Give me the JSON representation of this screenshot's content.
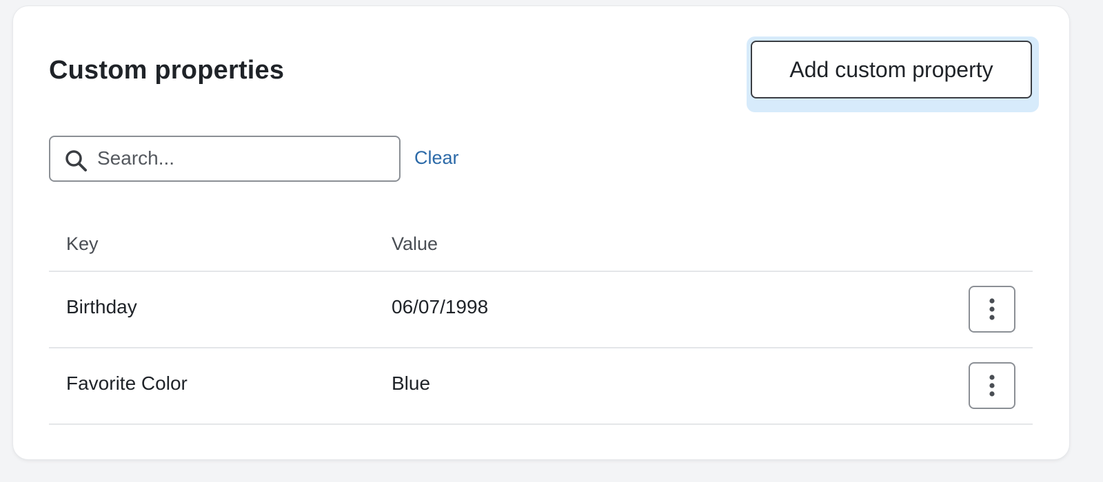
{
  "header": {
    "title": "Custom properties",
    "add_button_label": "Add custom property"
  },
  "search": {
    "placeholder": "Search...",
    "value": "",
    "icon": "search-icon",
    "clear_label": "Clear"
  },
  "table": {
    "columns": [
      "Key",
      "Value"
    ],
    "rows": [
      {
        "key": "Birthday",
        "value": "06/07/1998",
        "action_icon": "more-vertical-icon"
      },
      {
        "key": "Favorite Color",
        "value": "Blue",
        "action_icon": "more-vertical-icon"
      }
    ]
  },
  "colors": {
    "link": "#2c6aa8",
    "focus_ring": "#d7ebfb",
    "border": "#8b8f95",
    "divider": "#e4e6e9"
  }
}
